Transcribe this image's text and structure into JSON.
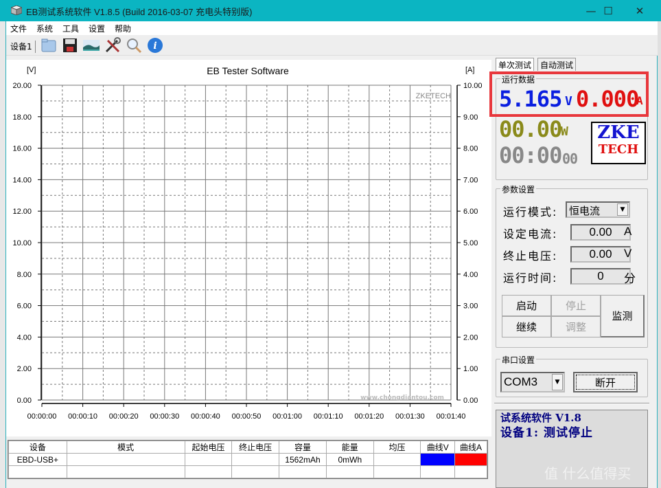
{
  "window": {
    "title": "EB测试系统软件 V1.8.5 (Build 2016-03-07 充电头特别版)",
    "controls": {
      "minimize": "—",
      "maximize": "☐",
      "close": "✕"
    }
  },
  "menu": [
    "文件",
    "系统",
    "工具",
    "设置",
    "帮助"
  ],
  "toolbar": {
    "device_tab": "设备1",
    "icons": [
      "folder-open-icon",
      "save-icon",
      "landscape-image-icon",
      "tools-icon",
      "magnifier-icon",
      "info-icon"
    ]
  },
  "chart_data": {
    "type": "line",
    "title": "EB Tester Software",
    "watermark": "ZKETECH",
    "ylabel": "[V]",
    "y2label": "[A]",
    "ylim": [
      0,
      20
    ],
    "y2lim": [
      0,
      10
    ],
    "yticks": [
      "0.00",
      "2.00",
      "4.00",
      "6.00",
      "8.00",
      "10.00",
      "12.00",
      "14.00",
      "16.00",
      "18.00",
      "20.00"
    ],
    "y2ticks": [
      "0.00",
      "1.00",
      "2.00",
      "3.00",
      "4.00",
      "5.00",
      "6.00",
      "7.00",
      "8.00",
      "9.00",
      "10.00"
    ],
    "xticks": [
      "00:00:00",
      "00:00:10",
      "00:00:20",
      "00:00:30",
      "00:00:40",
      "00:00:50",
      "00:01:00",
      "00:01:10",
      "00:01:20",
      "00:01:30",
      "00:01:40"
    ],
    "xlim_seconds": [
      0,
      100
    ],
    "grid": true,
    "series": [
      {
        "name": "曲线V",
        "color": "#0000ff",
        "values": []
      },
      {
        "name": "曲线A",
        "color": "#ff0000",
        "values": []
      }
    ]
  },
  "table": {
    "headers": [
      "设备",
      "模式",
      "起始电压",
      "终止电压",
      "容量",
      "能量",
      "均压",
      "曲线V",
      "曲线A"
    ],
    "rows": [
      [
        "EBD-USB+",
        "",
        "",
        "",
        "1562mAh",
        "0mWh",
        "",
        "",
        ""
      ],
      [
        "",
        "",
        "",
        "",
        "",
        "",
        "",
        "",
        ""
      ]
    ],
    "curve_colors": {
      "v": "#0000ff",
      "a": "#ff0000"
    }
  },
  "right_panel": {
    "tabs": [
      "单次测试",
      "自动测试"
    ],
    "active_tab": "单次测试",
    "run_data": {
      "label": "运行数据",
      "voltage": "5.165",
      "voltage_unit": "V",
      "current": "0.000",
      "current_unit": "A",
      "power": "00.00",
      "power_unit": "W",
      "time": "00:00",
      "time_seconds": "00",
      "logo_top": "ZKE",
      "logo_bottom": "TECH"
    },
    "params": {
      "label": "参数设置",
      "mode_label": "运行模式:",
      "mode_value": "恒电流",
      "current_label": "设定电流:",
      "current_value": "0.00",
      "current_unit": "A",
      "cutoff_label": "终止电压:",
      "cutoff_value": "0.00",
      "cutoff_unit": "V",
      "time_label": "运行时间:",
      "time_value": "0",
      "time_unit": "分",
      "buttons": {
        "start": "启动",
        "stop": "停止",
        "continue": "继续",
        "adjust": "调整",
        "monitor": "监测"
      }
    },
    "serial": {
      "label": "串口设置",
      "port": "COM3",
      "disconnect": "断开"
    },
    "status": {
      "line1": "试系统软件 V1.8",
      "line2": "设备1: 测试停止"
    }
  },
  "watermarks": {
    "site": "www.chongdiantou.com",
    "corner": "值 什么值得买"
  }
}
